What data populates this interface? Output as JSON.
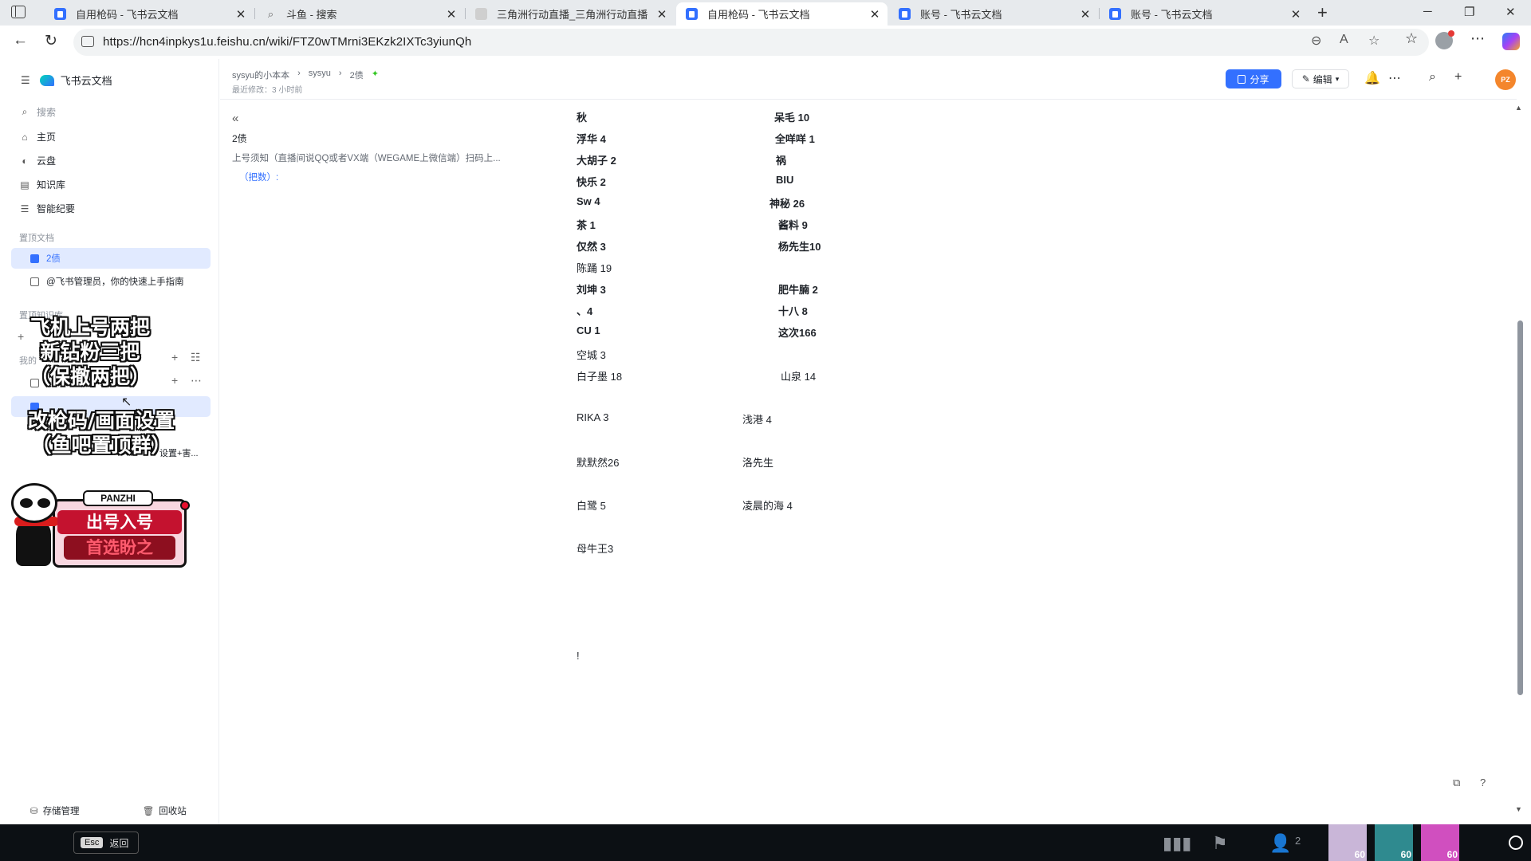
{
  "browser": {
    "tabs": [
      {
        "title": "自用枪码 - 飞书云文档",
        "icon": "doc-icon",
        "active": false
      },
      {
        "title": "斗鱼 - 搜索",
        "icon": "search-icon",
        "active": false
      },
      {
        "title": "三角洲行动直播_三角洲行动直播",
        "icon": "game-icon",
        "active": false
      },
      {
        "title": "自用枪码 - 飞书云文档",
        "icon": "doc-icon",
        "active": true
      },
      {
        "title": "账号 - 飞书云文档",
        "icon": "doc-icon",
        "active": false
      },
      {
        "title": "账号 - 飞书云文档",
        "icon": "doc-icon",
        "active": false
      }
    ],
    "url": "https://hcn4inpkys1u.feishu.cn/wiki/FTZ0wTMrni3EKzk2IXTc3yiunQh"
  },
  "sidebar": {
    "brand": "飞书云文档",
    "search_label": "搜索",
    "nav": [
      {
        "label": "主页",
        "icon": "home-icon"
      },
      {
        "label": "云盘",
        "icon": "cloud-drive-icon"
      },
      {
        "label": "知识库",
        "icon": "wiki-icon"
      },
      {
        "label": "智能纪要",
        "icon": "notes-icon"
      }
    ],
    "pinned_section": "置顶文档",
    "pinned_docs": [
      {
        "label": "2债",
        "selected": true
      },
      {
        "label": "@飞书管理员，你的快速上手指南",
        "selected": false
      }
    ],
    "pinned_wiki_section": "置顶知识库",
    "my_section": "我的",
    "partial_item": "设置+害...",
    "footer": {
      "storage": "存储管理",
      "trash": "回收站"
    }
  },
  "overlay": {
    "line1": "飞机上号两把",
    "line2": "新钻粉三把",
    "line3": "（保撤两把）",
    "line4": "改枪码/画面设置",
    "line5": "（鱼吧置顶群）",
    "badge_name": "PANZHI",
    "badge_line1": "出号入号",
    "badge_line2": "首选盼之"
  },
  "doc": {
    "breadcrumb": [
      "sysyu的小本本",
      "sysyu",
      "2债"
    ],
    "modified": "最近修改：3 小时前",
    "share_label": "分享",
    "edit_label": "编辑",
    "avatar_initials": "PZ",
    "outline": {
      "title": "2债",
      "h2": "上号须知（直播间说QQ或者VX端（WEGAME上微信端）扫码上...",
      "h3": "（把数）:"
    },
    "col_left": [
      "秋",
      "浮华 4",
      "大胡子 2",
      "快乐 2",
      "Sw 4",
      "茶 1",
      "仅然 3",
      "陈踊 19",
      "刘坤 3",
      "、4",
      "CU 1",
      "空城 3",
      "白子墨 18",
      "RIKA 3",
      "默默然26",
      "白鹭 5",
      "母牛王3",
      "!"
    ],
    "col_right": [
      "呆毛 10",
      "全咩咩 1",
      "祸",
      "BIU",
      "神秘 26",
      "酱料  9",
      "杨先生10",
      "肥牛腩 2",
      "十八 8",
      "这次166",
      "山泉 14",
      "浅港 4",
      "洛先生",
      "凌晨的海 4"
    ]
  },
  "game": {
    "esc_key": "Esc",
    "esc_label": "返回",
    "squad_count": "2",
    "portraits": [
      {
        "level": "60",
        "color": "#c9b6d8"
      },
      {
        "level": "60",
        "color": "#2f8a8f"
      },
      {
        "level": "60",
        "color": "#d04fbf"
      }
    ]
  }
}
